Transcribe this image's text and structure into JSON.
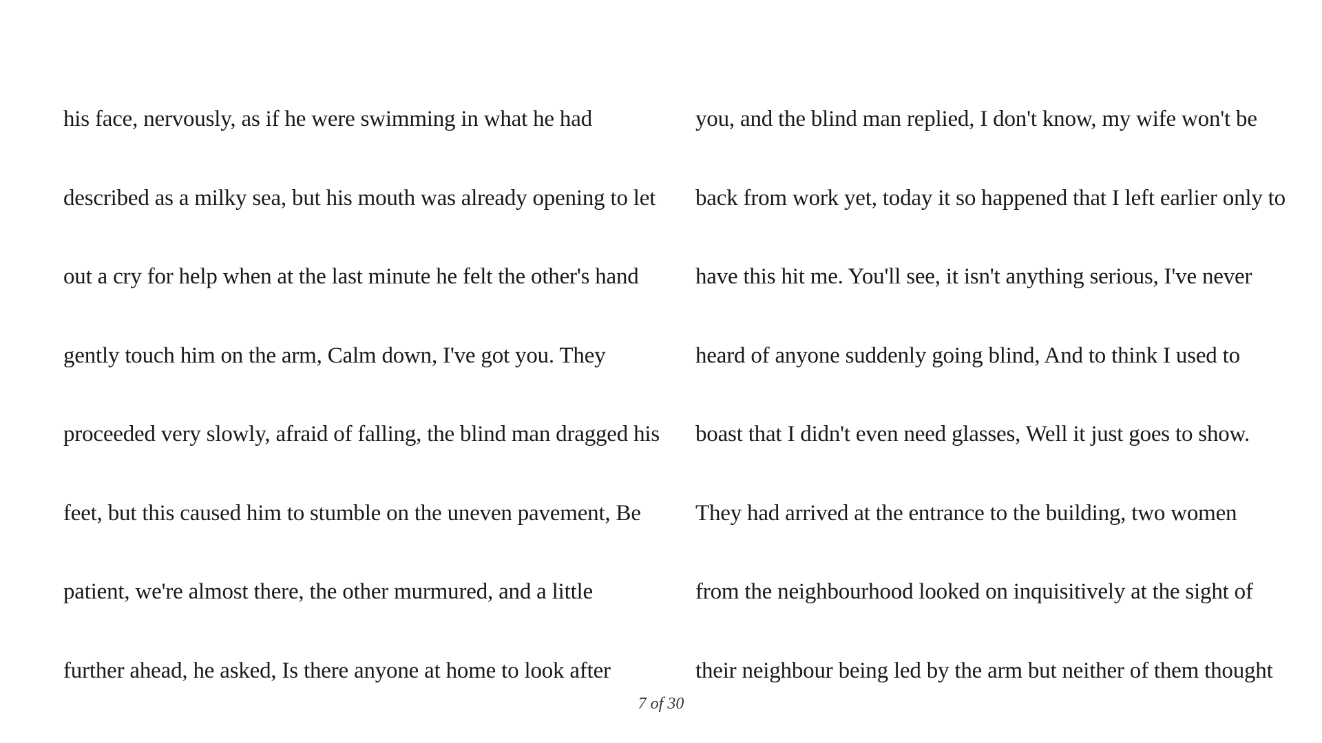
{
  "reader": {
    "left_column": [
      "his face, nervously, as if he were swimming in what he had",
      "described as a milky sea, but his mouth was already opening to let",
      "out a cry for help when at the last minute he felt the other's hand",
      "gently touch him on the arm, Calm down, I've got you. They",
      "proceeded very slowly, afraid of falling, the blind man dragged his",
      "feet, but this caused him to stumble on the uneven pavement, Be",
      "patient, we're almost there, the other murmured, and a little",
      "further ahead, he asked, Is there anyone at home to look after"
    ],
    "right_column": [
      "you, and the blind man replied, I don't know, my wife won't be",
      "back from work yet, today it so happened that I left earlier only to",
      "have this hit me. You'll see, it isn't anything serious, I've never",
      "heard of anyone suddenly going blind, And to think I used to",
      "boast that I didn't even need glasses, Well it just goes to show.",
      "They had arrived at the entrance to the building, two women",
      "from the neighbourhood looked on inquisitively at the sight of",
      "their neighbour being led by the arm but neither of them thought"
    ],
    "page_indicator": "7 of 30"
  }
}
